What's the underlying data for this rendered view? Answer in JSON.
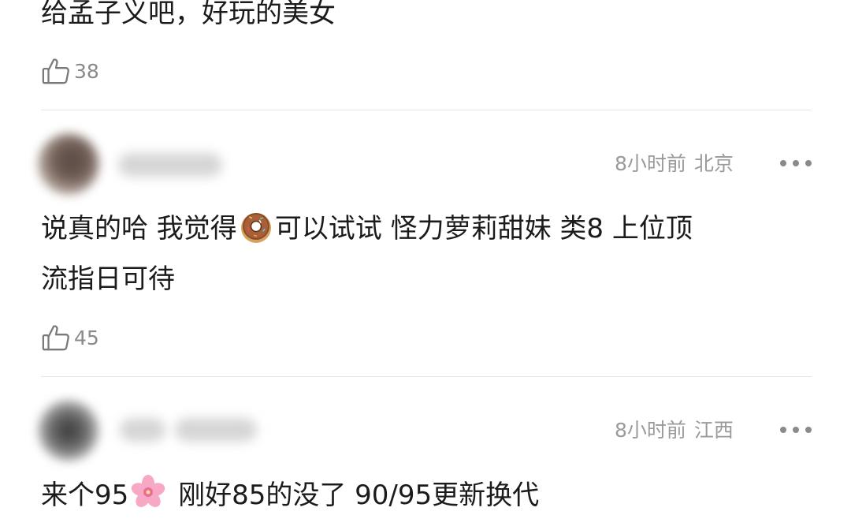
{
  "comments": [
    {
      "text": "给孟子义吧，好玩的美女",
      "likes": "38"
    },
    {
      "time": "8小时前",
      "location": "北京",
      "text_a": "说真的哈 我觉得",
      "emoji": "donut-emoji",
      "text_b": "可以试试 怪力萝莉甜妹 类8  上位顶",
      "text_line2": "流指日可待",
      "likes": "45"
    },
    {
      "time": "8小时前",
      "location": "江西",
      "text_a": "来个95",
      "emoji": "cherry-blossom-emoji",
      "text_b": " 刚好85的没了 90/95更新换代"
    }
  ],
  "icons": {
    "like": "thumbs-up-icon",
    "more": "more-dots-icon"
  },
  "colors": {
    "text": "#1b1b1b",
    "meta": "#9a9a9a",
    "divider": "#e6e6e6"
  }
}
